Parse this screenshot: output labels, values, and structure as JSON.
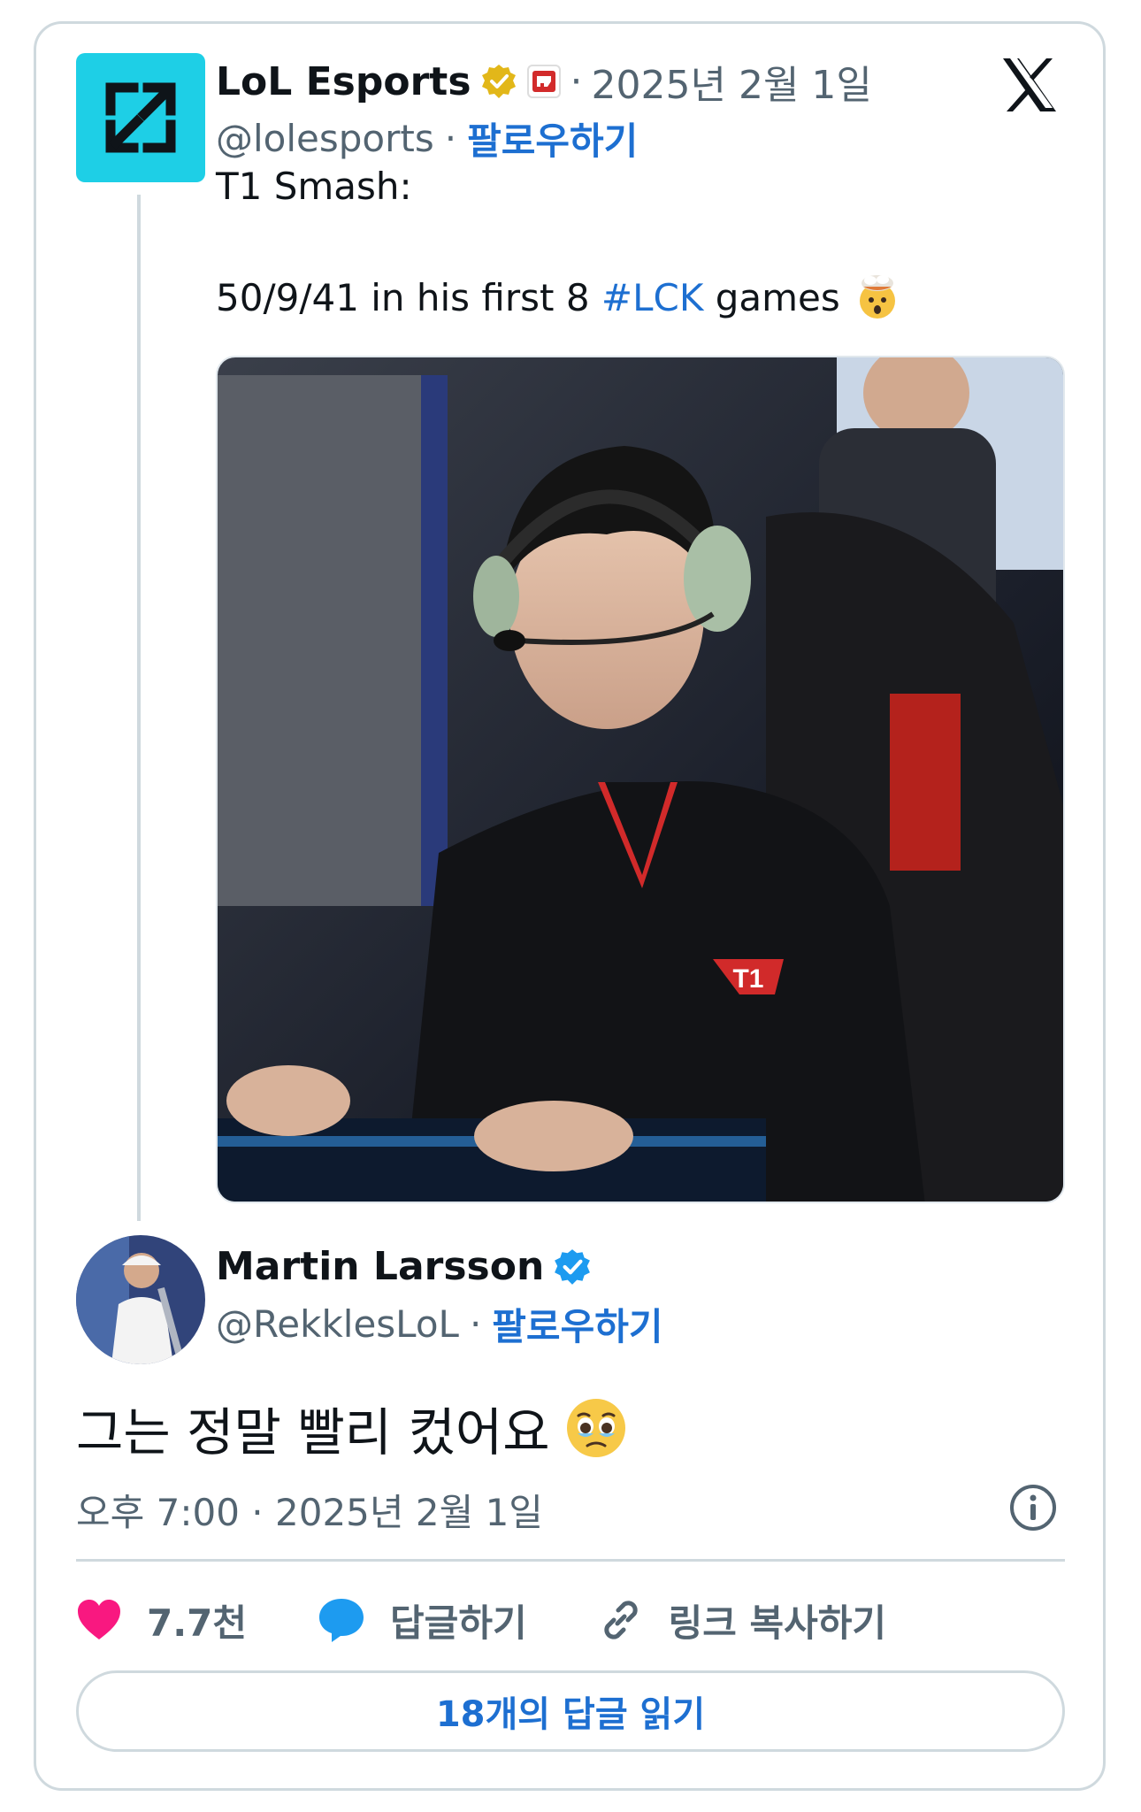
{
  "quoted": {
    "name": "LoL Esports",
    "date_sep": "·",
    "date": "2025년 2월 1일",
    "handle": "@lolesports",
    "dot": "·",
    "follow": "팔로우하기",
    "text_line1": "T1 Smash:",
    "text_line2_pre": "50/9/41 in his first 8 ",
    "hashtag": "#LCK",
    "text_line2_post": " games",
    "emoji": "exploding-head-emoji"
  },
  "main": {
    "name": "Martin Larsson",
    "handle": "@RekklesLoL",
    "dot": "·",
    "follow": "팔로우하기",
    "text": "그는 정말 빨리 컸어요",
    "emoji": "face-holding-back-tears-emoji",
    "timestamp": "오후 7:00 · 2025년 2월 1일"
  },
  "actions": {
    "likes": "7.7천",
    "reply": "답글하기",
    "copy_link": "링크 복사하기"
  },
  "read_replies": "18개의 답글 읽기",
  "colors": {
    "accent": "#1d6fd1",
    "like": "#f91880",
    "reply": "#1d9bf0",
    "verified_gold": "#e2b719",
    "verified_blue": "#1d9bf0",
    "lol_avatar": "#1ecfe6"
  }
}
